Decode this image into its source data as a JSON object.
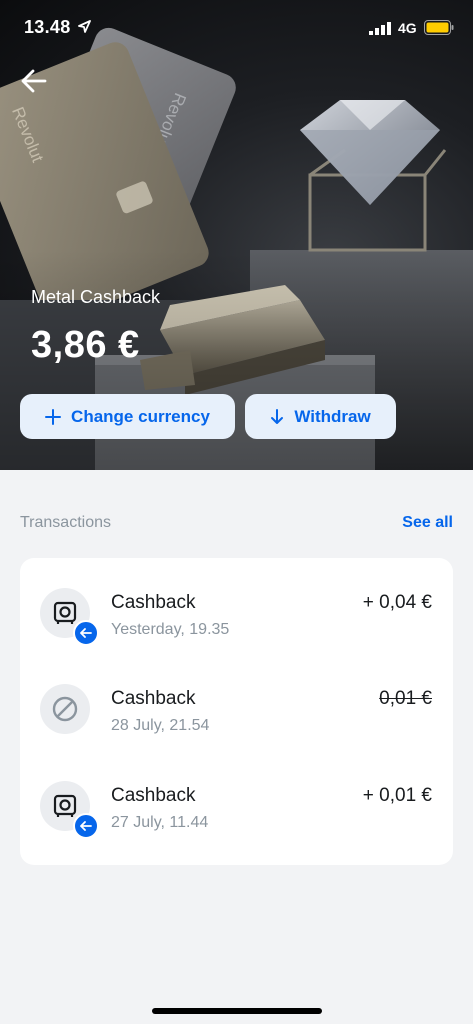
{
  "status_bar": {
    "time": "13.48",
    "network": "4G",
    "colors": {
      "battery": "#ffcc00"
    }
  },
  "header": {
    "back_icon": "arrow-left-icon",
    "card_brand": "Revolut"
  },
  "balance": {
    "label": "Metal Cashback",
    "amount": "3,86 €"
  },
  "actions": {
    "change_currency": {
      "label": "Change currency",
      "icon": "plus-icon"
    },
    "withdraw": {
      "label": "Withdraw",
      "icon": "arrow-down-icon"
    }
  },
  "transactions": {
    "title": "Transactions",
    "see_all": "See all",
    "items": [
      {
        "name": "Cashback",
        "date": "Yesterday, 19.35",
        "amount": "+ 0,04 €",
        "icon": "safe-icon",
        "badge": "arrow-left-icon",
        "declined": false
      },
      {
        "name": "Cashback",
        "date": "28 July, 21.54",
        "amount": "0,01 €",
        "icon": "declined-icon",
        "declined": true
      },
      {
        "name": "Cashback",
        "date": "27 July, 11.44",
        "amount": "+ 0,01 €",
        "icon": "safe-icon",
        "badge": "arrow-left-icon",
        "declined": false
      }
    ]
  },
  "colors": {
    "accent": "#0666eb",
    "button_bg": "#e7f0fb",
    "page_bg": "#f2f3f5",
    "secondary_text": "#8b959e"
  }
}
